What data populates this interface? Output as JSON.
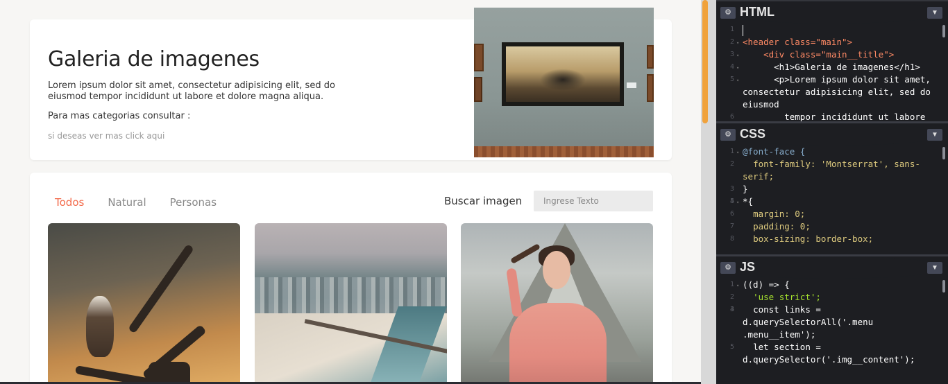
{
  "preview": {
    "hero": {
      "title": "Galeria de imagenes",
      "lorem": "Lorem ipsum dolor sit amet, consectetur adipisicing elit, sed do eiusmod tempor incididunt ut labore et dolore magna aliqua.",
      "categories_text": "Para mas categorias consultar :",
      "more_link": "si deseas ver mas click aqui"
    },
    "menu": [
      "Todos",
      "Natural",
      "Personas"
    ],
    "active_menu": "Todos",
    "search": {
      "label": "Buscar imagen",
      "placeholder": "Ingrese Texto"
    },
    "accent_color": "#f36a4a"
  },
  "editors": {
    "html": {
      "title": "HTML",
      "lines": [
        {
          "n": "1",
          "text": ""
        },
        {
          "n": "2",
          "text": "<header class=\"main\">"
        },
        {
          "n": "3",
          "text": "    <div class=\"main__title\">"
        },
        {
          "n": "4",
          "text": "      <h1>Galeria de imagenes</h1>"
        },
        {
          "n": "5",
          "text": "      <p>Lorem ipsum dolor sit amet, consectetur adipisicing elit, sed do eiusmod"
        },
        {
          "n": "6",
          "text": "        tempor incididunt ut labore"
        }
      ]
    },
    "css": {
      "title": "CSS",
      "lines": [
        {
          "n": "1",
          "text": "@font-face {"
        },
        {
          "n": "2",
          "text": "  font-family: 'Montserrat', sans-serif;"
        },
        {
          "n": "3",
          "text": "}"
        },
        {
          "n": "4",
          "text": ""
        },
        {
          "n": "5",
          "text": "*{"
        },
        {
          "n": "6",
          "text": "  margin: 0;"
        },
        {
          "n": "7",
          "text": "  padding: 0;"
        },
        {
          "n": "8",
          "text": "  box-sizing: border-box;"
        }
      ]
    },
    "js": {
      "title": "JS",
      "lines": [
        {
          "n": "1",
          "text": "((d) => {"
        },
        {
          "n": "2",
          "text": "  'use strict';"
        },
        {
          "n": "3",
          "text": ""
        },
        {
          "n": "4",
          "text": "  const links = d.querySelectorAll('.menu .menu__item');"
        },
        {
          "n": "5",
          "text": "  let section = d.querySelector('.img__content');"
        }
      ]
    }
  }
}
